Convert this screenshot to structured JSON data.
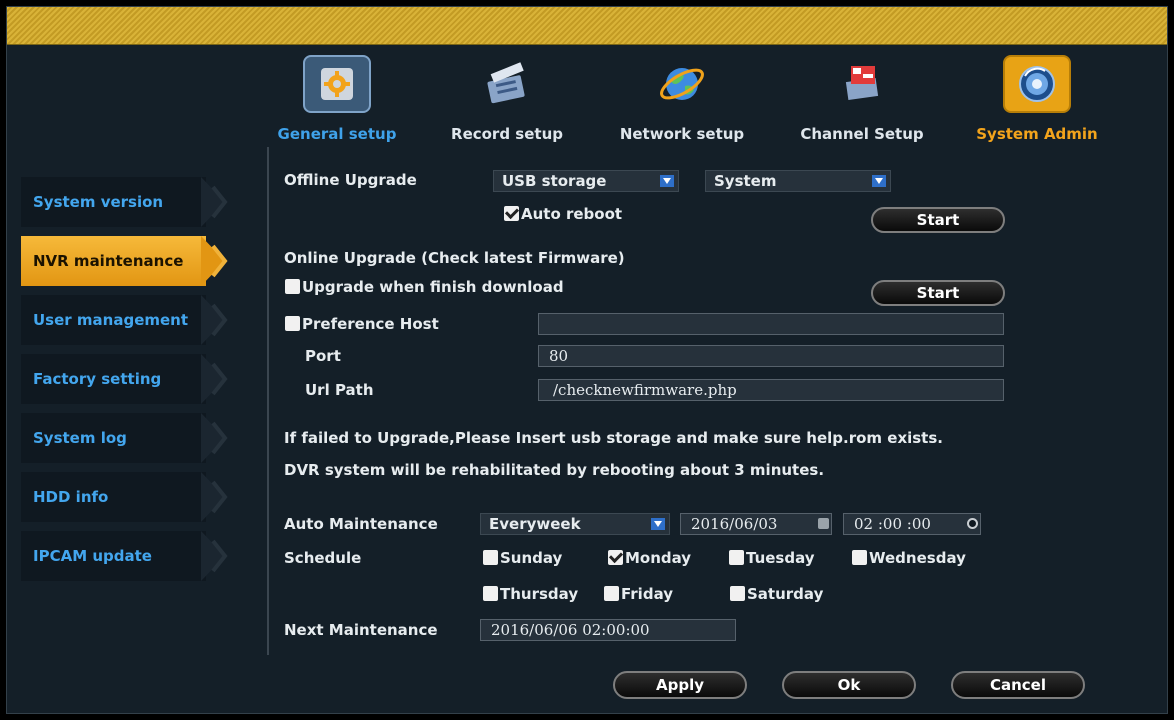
{
  "nav": {
    "tabs": [
      {
        "label": "General setup",
        "icon": "gear-icon",
        "state": "selected",
        "color": "#3fa2ea"
      },
      {
        "label": "Record setup",
        "icon": "clapper-icon",
        "state": "normal"
      },
      {
        "label": "Network setup",
        "icon": "globe-icon",
        "state": "normal"
      },
      {
        "label": "Channel Setup",
        "icon": "channel-icon",
        "state": "normal"
      },
      {
        "label": "System Admin",
        "icon": "admin-icon",
        "state": "active",
        "color": "#f3a41c"
      }
    ]
  },
  "sidebar": {
    "items": [
      {
        "label": "System version",
        "active": false
      },
      {
        "label": "NVR maintenance",
        "active": true
      },
      {
        "label": "User management",
        "active": false
      },
      {
        "label": "Factory setting",
        "active": false
      },
      {
        "label": "System log",
        "active": false
      },
      {
        "label": "HDD info",
        "active": false
      },
      {
        "label": "IPCAM update",
        "active": false
      }
    ]
  },
  "offline": {
    "label": "Offline Upgrade",
    "source_value": "USB storage",
    "type_value": "System",
    "auto_reboot_label": "Auto reboot",
    "auto_reboot_checked": true,
    "start_label": "Start"
  },
  "online": {
    "label": "Online Upgrade (Check latest Firmware)",
    "upgrade_label": "Upgrade when finish download",
    "upgrade_checked": false,
    "start_label": "Start",
    "pref_host_label": "Preference Host",
    "pref_host_checked": false,
    "pref_host_value": "",
    "port_label": "Port",
    "port_value": "80",
    "url_label": "Url Path",
    "url_value": "/checknewfirmware.php"
  },
  "messages": {
    "line1": "If failed to Upgrade,Please Insert usb storage and make sure help.rom exists.",
    "line2": "DVR system will be rehabilitated by rebooting about 3 minutes."
  },
  "auto": {
    "label": "Auto Maintenance",
    "frequency_value": "Everyweek",
    "date_value": "2016/06/03",
    "time_value": "02 :00 :00",
    "schedule_label": "Schedule",
    "days": [
      {
        "label": "Sunday",
        "checked": false
      },
      {
        "label": "Monday",
        "checked": true
      },
      {
        "label": "Tuesday",
        "checked": false
      },
      {
        "label": "Wednesday",
        "checked": false
      },
      {
        "label": "Thursday",
        "checked": false
      },
      {
        "label": "Friday",
        "checked": false
      },
      {
        "label": "Saturday",
        "checked": false
      }
    ],
    "next_label": "Next Maintenance",
    "next_value": "2016/06/06 02:00:00"
  },
  "buttons": {
    "apply": "Apply",
    "ok": "Ok",
    "cancel": "Cancel"
  }
}
